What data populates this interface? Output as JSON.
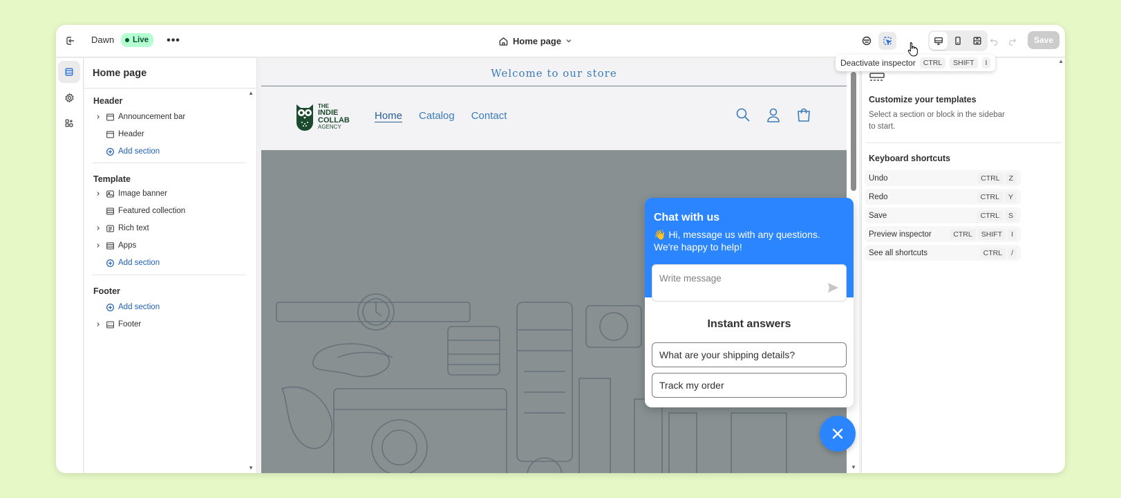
{
  "topbar": {
    "theme_name": "Dawn",
    "status_badge": "Live",
    "more_label": "•••",
    "page_select": "Home page",
    "save_label": "Save"
  },
  "tooltip": {
    "text": "Deactivate inspector",
    "keys": [
      "CTRL",
      "SHIFT",
      "I"
    ]
  },
  "sidebar": {
    "title": "Home page",
    "header_group": "Header",
    "header_items": [
      "Announcement bar",
      "Header"
    ],
    "template_group": "Template",
    "template_items": [
      "Image banner",
      "Featured collection",
      "Rich text",
      "Apps"
    ],
    "footer_group": "Footer",
    "footer_items": [
      "Footer"
    ],
    "add_section": "Add section"
  },
  "store": {
    "announcement": "Welcome to our store",
    "logo_lines": [
      "THE",
      "INDIE",
      "COLLAB",
      "AGENCY"
    ],
    "nav": [
      "Home",
      "Catalog",
      "Contact"
    ]
  },
  "chat": {
    "title": "Chat with us",
    "subtitle": "👋 Hi, message us with any questions. We're happy to help!",
    "placeholder": "Write message",
    "instant_title": "Instant answers",
    "faqs": [
      "What are your shipping details?",
      "Track my order"
    ]
  },
  "right_panel": {
    "title": "Customize your templates",
    "description": "Select a section or block in the sidebar to start.",
    "shortcuts_title": "Keyboard shortcuts",
    "shortcuts": [
      {
        "label": "Undo",
        "keys": [
          "CTRL",
          "Z"
        ]
      },
      {
        "label": "Redo",
        "keys": [
          "CTRL",
          "Y"
        ]
      },
      {
        "label": "Save",
        "keys": [
          "CTRL",
          "S"
        ]
      },
      {
        "label": "Preview inspector",
        "keys": [
          "CTRL",
          "SHIFT",
          "I"
        ]
      },
      {
        "label": "See all shortcuts",
        "keys": [
          "CTRL",
          "/"
        ]
      }
    ]
  },
  "colors": {
    "page_bg": "#e6f8c6",
    "accent": "#2a85ff",
    "live_badge": "#b4fed2",
    "store_link": "#3a7bb7"
  }
}
